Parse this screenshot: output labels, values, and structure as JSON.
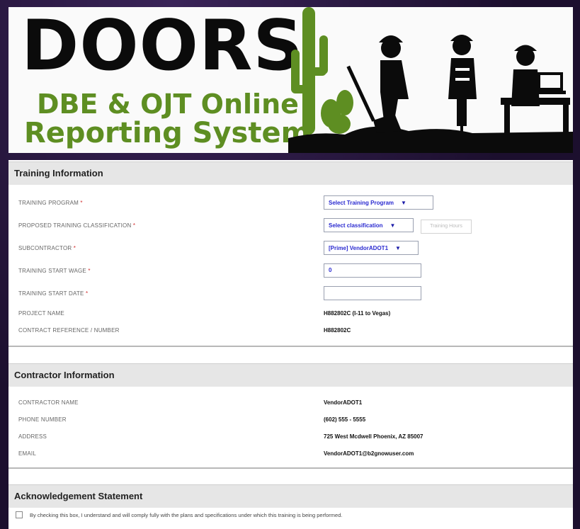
{
  "banner": {
    "title": "DOORS",
    "subtitle_line1": "DBE & OJT Online",
    "subtitle_line2": "Reporting System",
    "colors": {
      "title": "#0b0b0b",
      "subtitle": "#5e8e22"
    }
  },
  "training": {
    "section_title": "Training Information",
    "program_label": "TRAINING PROGRAM",
    "program_value": "Select Training Program",
    "classification_label": "PROPOSED TRAINING CLASSIFICATION",
    "classification_value": "Select classification",
    "hours_placeholder": "Training Hours",
    "subcontractor_label": "SUBCONTRACTOR",
    "subcontractor_value": "[Prime] VendorADOT1",
    "start_wage_label": "TRAINING START WAGE",
    "start_wage_value": "0",
    "start_date_label": "TRAINING START DATE",
    "start_date_value": "",
    "project_name_label": "PROJECT NAME",
    "project_name_value": "H882802C (I-11 to Vegas)",
    "contract_ref_label": "CONTRACT REFERENCE / NUMBER",
    "contract_ref_value": "H882802C",
    "required_marker": "*"
  },
  "contractor": {
    "section_title": "Contractor Information",
    "name_label": "CONTRACTOR NAME",
    "name_value": "VendorADOT1",
    "phone_label": "PHONE NUMBER",
    "phone_value": "(602) 555 - 5555",
    "address_label": "ADDRESS",
    "address_value": "725 West Mcdwell Phoenix, AZ 85007",
    "email_label": "EMAIL",
    "email_value": "VendorADOT1@b2gnowuser.com"
  },
  "acknowledgement": {
    "section_title": "Acknowledgement Statement",
    "checkbox_text": "By checking this box, I understand and will comply fully with the plans and specifications under which this training is being performed.",
    "checked": false
  },
  "icons": {
    "dropdown_caret": "▼"
  }
}
